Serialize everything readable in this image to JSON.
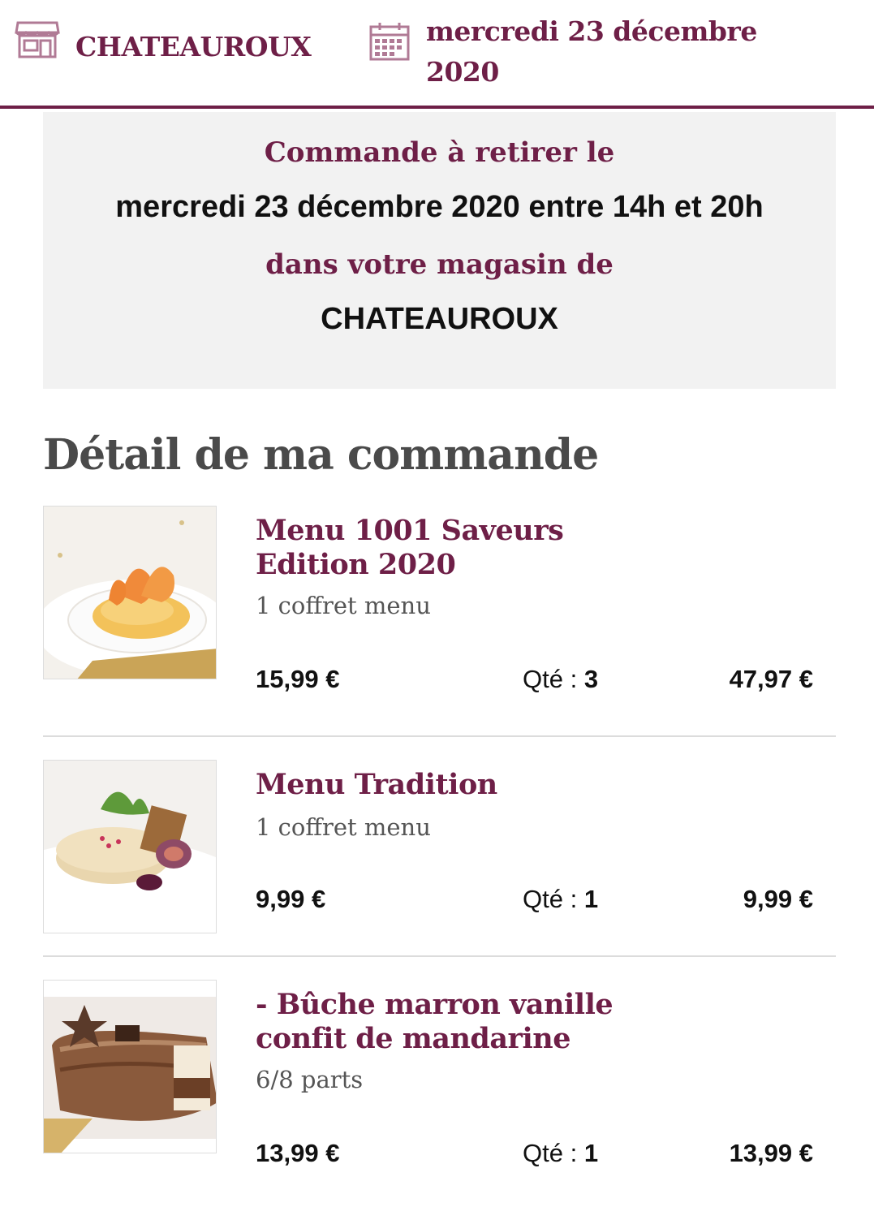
{
  "header": {
    "store_name": "CHATEAUROUX",
    "date": "mercredi 23 décembre 2020",
    "store_icon": "store-icon",
    "calendar_icon": "calendar-icon"
  },
  "pickup": {
    "intro": "Commande à retirer le",
    "datetime": "mercredi 23 décembre 2020 entre 14h et 20h",
    "store_intro": "dans votre magasin de",
    "store": "CHATEAUROUX"
  },
  "section_title": "Détail de ma commande",
  "items": [
    {
      "name": "Menu 1001 Saveurs Edition 2020",
      "subtitle": "1 coffret menu",
      "unit_price": "15,99 €",
      "qty_label": "Qté : ",
      "qty": "3",
      "total": "47,97 €"
    },
    {
      "name": "Menu Tradition",
      "subtitle": "1 coffret menu",
      "unit_price": "9,99 €",
      "qty_label": "Qté : ",
      "qty": "1",
      "total": "9,99 €"
    },
    {
      "name": "- Bûche marron vanille confit de mandarine",
      "subtitle": "6/8 parts",
      "unit_price": "13,99 €",
      "qty_label": "Qté : ",
      "qty": "1",
      "total": "13,99 €"
    }
  ],
  "colors": {
    "brand": "#6e1f47",
    "panel": "#f2f2f2",
    "title_gray": "#4a4a4a"
  }
}
